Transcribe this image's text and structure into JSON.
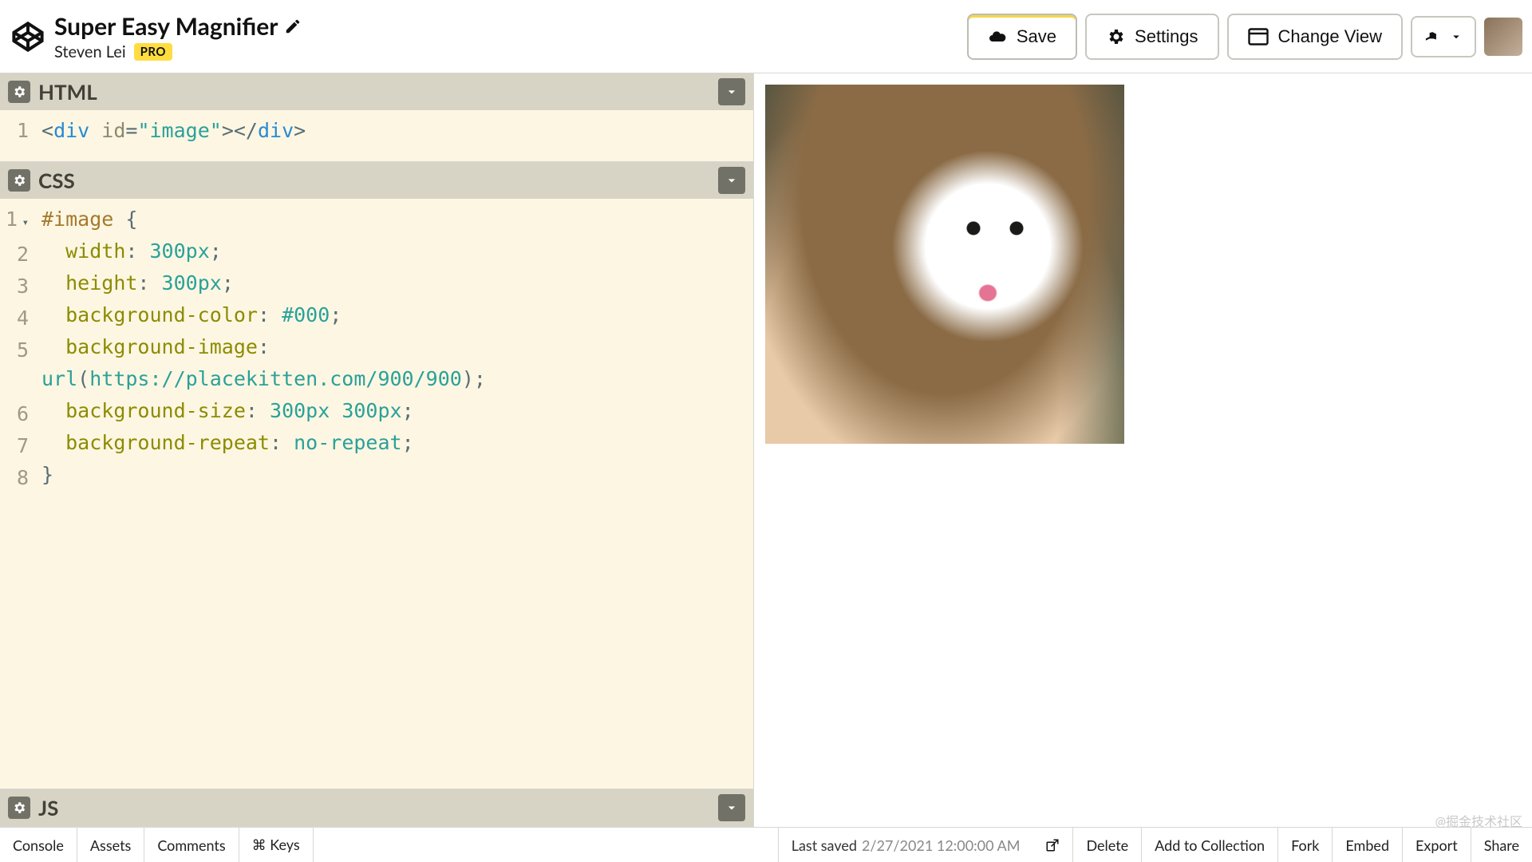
{
  "header": {
    "title": "Super Easy Magnifier",
    "author": "Steven Lei",
    "pro": "PRO",
    "save": "Save",
    "settings": "Settings",
    "change_view": "Change View"
  },
  "panels": {
    "html": {
      "title": "HTML"
    },
    "css": {
      "title": "CSS"
    },
    "js": {
      "title": "JS"
    }
  },
  "code": {
    "html_lines": [
      "<div id=\"image\"></div>"
    ],
    "css_lines": [
      "#image {",
      "  width: 300px;",
      "  height: 300px;",
      "  background-color: #000;",
      "  background-image: url(https://placekitten.com/900/900);",
      "  background-size: 300px 300px;",
      "  background-repeat: no-repeat;",
      "}"
    ]
  },
  "footer": {
    "console": "Console",
    "assets": "Assets",
    "comments": "Comments",
    "keys": "⌘ Keys",
    "last_saved_label": "Last saved",
    "last_saved_time": "2/27/2021 12:00:00 AM",
    "delete": "Delete",
    "add_collection": "Add to Collection",
    "fork": "Fork",
    "embed": "Embed",
    "export": "Export",
    "share": "Share",
    "watermark": "@掘金技术社区"
  }
}
